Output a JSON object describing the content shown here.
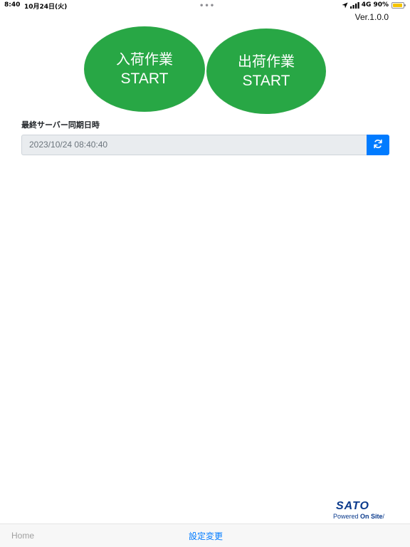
{
  "status_bar": {
    "time": "8:40",
    "date": "10月24日(火)",
    "network": "4G",
    "battery": "90%",
    "battery_level": 0.9,
    "icons": [
      "location-icon",
      "signal-icon",
      "battery-icon"
    ]
  },
  "header": {
    "version": "Ver.1.0.0"
  },
  "buttons": {
    "receiving": {
      "label_jp": "入荷作業",
      "label_en": "START"
    },
    "shipping": {
      "label_jp": "出荷作業",
      "label_en": "START"
    }
  },
  "sync": {
    "label": "最終サーバー同期日時",
    "value": "2023/10/24 08:40:40",
    "button_icon": "sync-icon"
  },
  "logo": {
    "brand": "SATO",
    "tagline_prefix": "Powered ",
    "tagline_bold": "On Site",
    "tagline_suffix": "/"
  },
  "tab_bar": {
    "home_label": "Home",
    "settings_label": "設定変更"
  },
  "colors": {
    "primary_green": "#28a745",
    "sync_blue": "#007bff",
    "brand_navy": "#0a3a8c",
    "battery_yellow": "#f5c400"
  }
}
